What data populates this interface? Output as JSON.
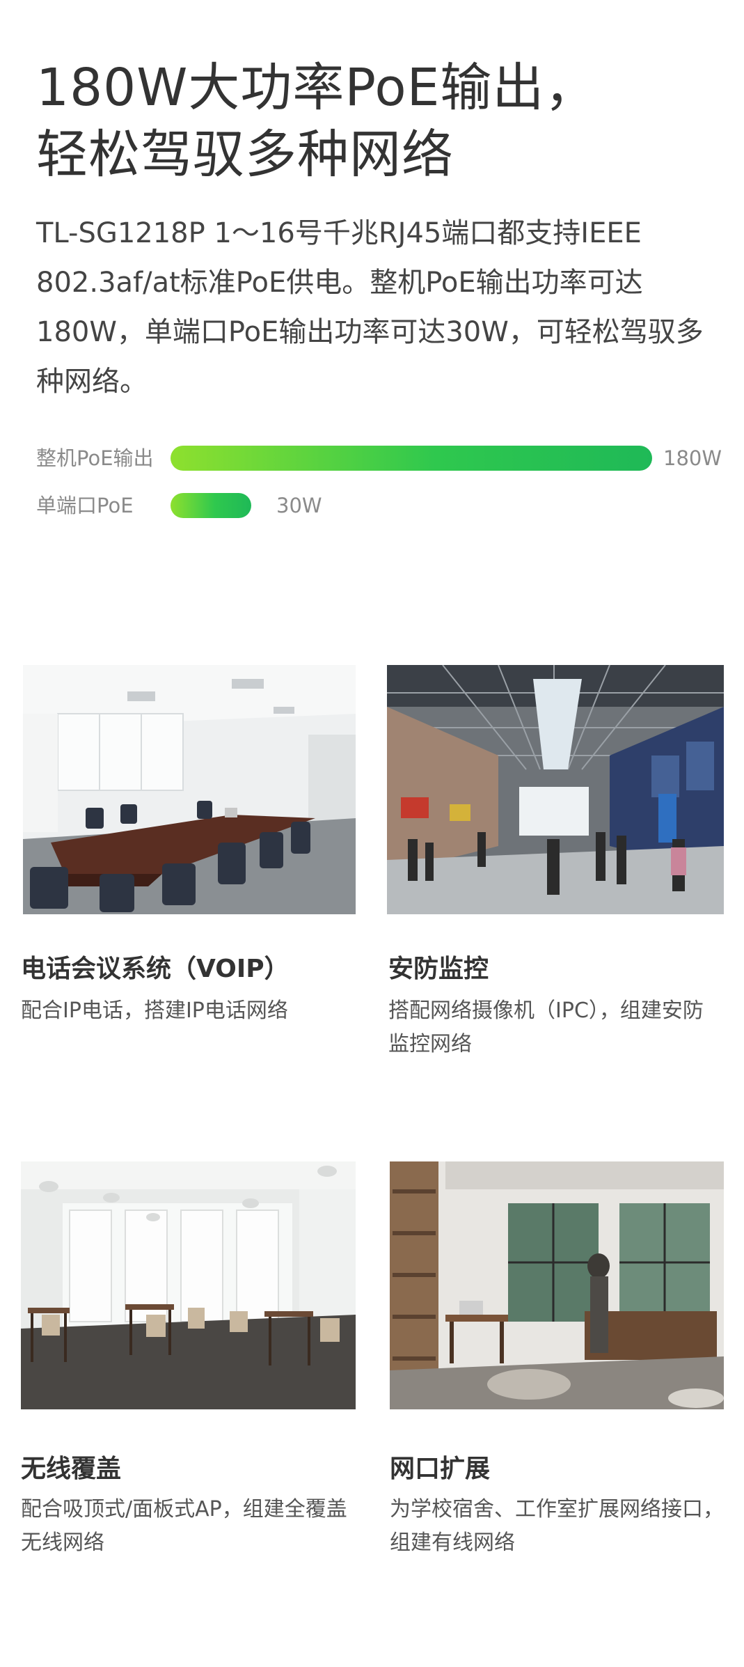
{
  "headline": {
    "line1": "180W大功率PoE输出，",
    "line2": "轻松驾驭多种网络"
  },
  "intro": "TL-SG1218P 1～16号千兆RJ45端口都支持IEEE 802.3af/at标准PoE供电。整机PoE输出功率可达180W，单端口PoE输出功率可达30W，可轻松驾驭多种网络。",
  "power_bars": [
    {
      "label": "整机PoE输出",
      "value": "180W",
      "level_percent": 100
    },
    {
      "label": "单端口PoE",
      "value": "30W",
      "level_percent": 16.7
    }
  ],
  "colors": {
    "bar_start": "#8ee02e",
    "bar_end": "#1fb957"
  },
  "scenarios": [
    {
      "title": "电话会议系统（VOIP）",
      "desc": "配合IP电话，搭建IP电话网络",
      "image": "conference-room-photo"
    },
    {
      "title": "安防监控",
      "desc": "搭配网络摄像机（IPC），组建安防监控网络",
      "image": "shopping-mall-photo"
    },
    {
      "title": "无线覆盖",
      "desc": "配合吸顶式/面板式AP，组建全覆盖无线网络",
      "image": "cafe-dining-photo"
    },
    {
      "title": "网口扩展",
      "desc": "为学校宿舍、工作室扩展网络接口，组建有线网络",
      "image": "home-studio-photo"
    }
  ]
}
